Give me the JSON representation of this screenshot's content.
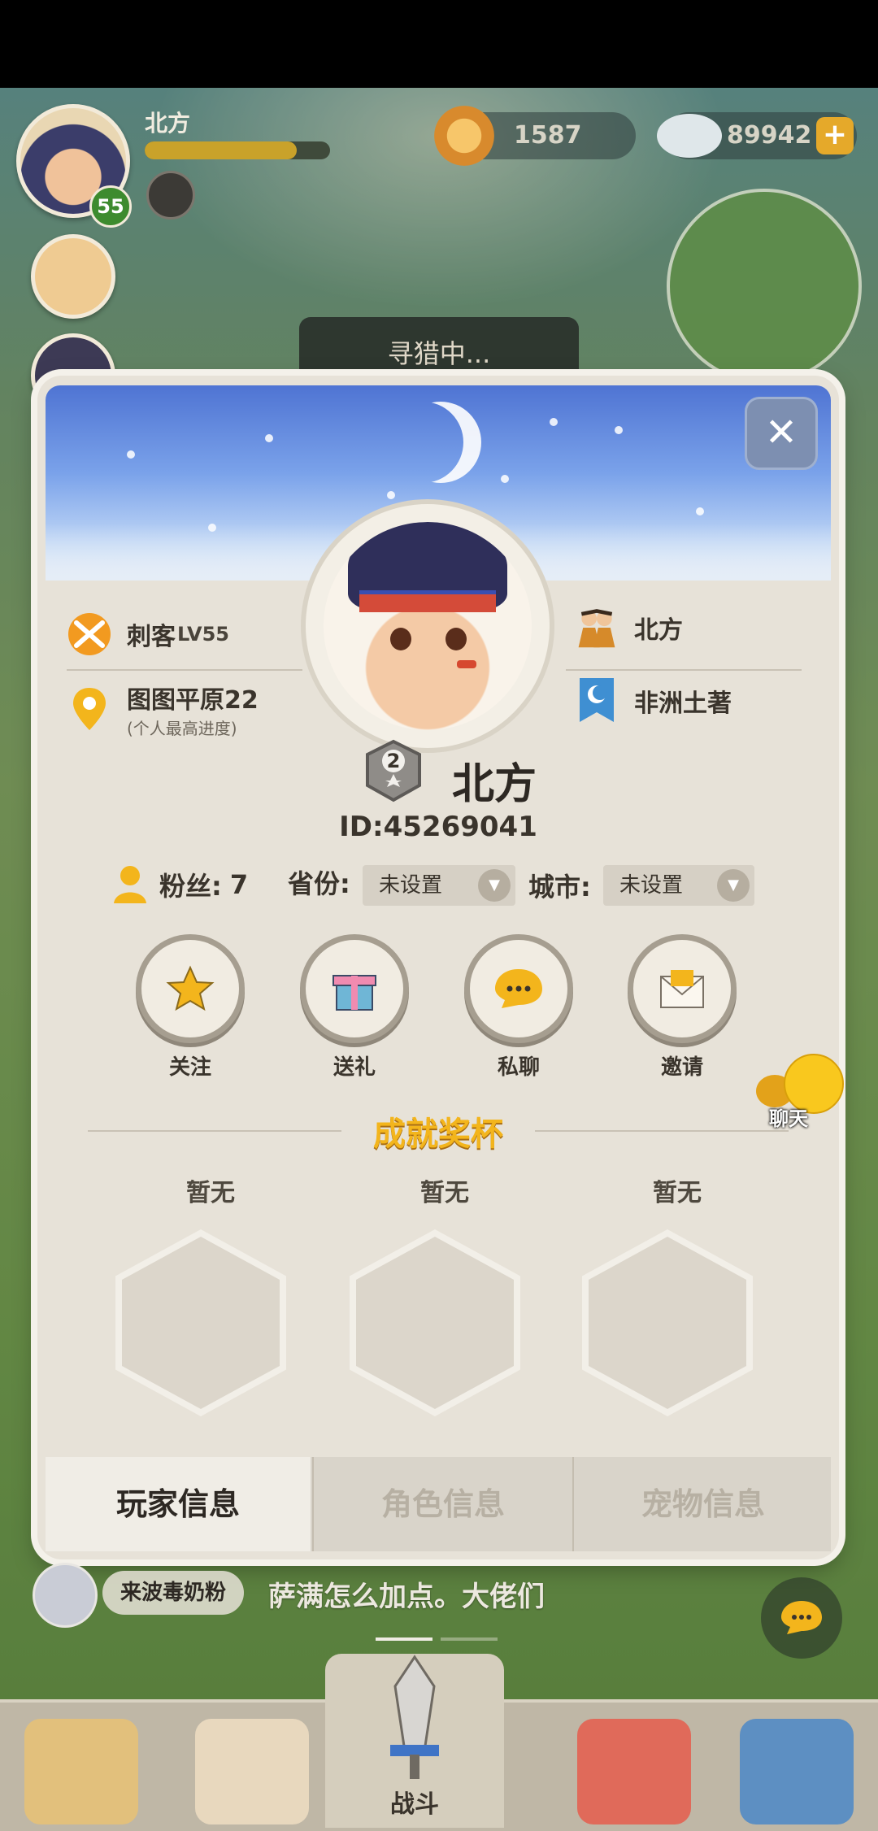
{
  "hud": {
    "player_name": "北方",
    "player_level": "55",
    "currency_shells": "1587",
    "currency_stones": "89942",
    "hunting_status": "寻猎中..."
  },
  "profile": {
    "class_label": "刺客",
    "class_level": "LV55",
    "location": "图图平原22",
    "location_note": "(个人最高进度)",
    "tribe_name": "北方",
    "title_name": "非洲土著",
    "rank_number": "2",
    "name": "北方",
    "id_text": "ID:45269041",
    "fans_label": "粉丝:",
    "fans_count": "7",
    "province_label": "省份:",
    "province_value": "未设置",
    "city_label": "城市:",
    "city_value": "未设置"
  },
  "actions": [
    {
      "label": "关注",
      "icon": "star-icon"
    },
    {
      "label": "送礼",
      "icon": "gift-icon"
    },
    {
      "label": "私聊",
      "icon": "chat-bubble-icon"
    },
    {
      "label": "邀请",
      "icon": "envelope-icon"
    }
  ],
  "trophies": {
    "section_title": "成就奖杯",
    "items": [
      {
        "label": "暂无"
      },
      {
        "label": "暂无"
      },
      {
        "label": "暂无"
      }
    ]
  },
  "chat_float_label": "聊天",
  "tabs": [
    {
      "label": "玩家信息",
      "active": true
    },
    {
      "label": "角色信息",
      "active": false
    },
    {
      "label": "宠物信息",
      "active": false
    }
  ],
  "chat": {
    "sender": "来波毒奶粉",
    "message": "萨满怎么加点。大佬们"
  },
  "bottom_nav": {
    "battle_label": "战斗"
  },
  "colors": {
    "accent_gold": "#f3b51c",
    "tab_active_bg": "#f0ede6",
    "tab_inactive_text": "#b7b0a3"
  }
}
